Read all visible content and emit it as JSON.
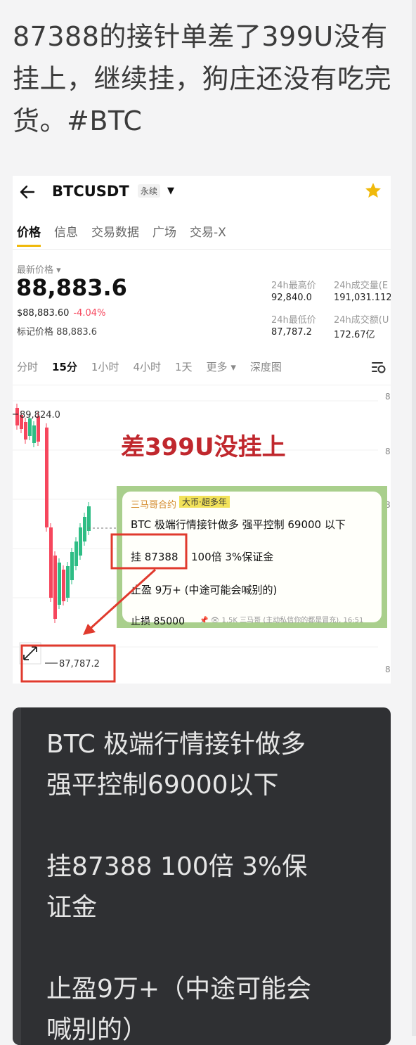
{
  "post": {
    "text": "87388的接针单差了399U没有挂上，继续挂，狗庄还没有吃完货。#BTC"
  },
  "app": {
    "symbol": "BTCUSDT",
    "badge": "永续",
    "tabs": [
      "价格",
      "信息",
      "交易数据",
      "广场",
      "交易-X"
    ],
    "latest_label": "最新价格",
    "price": "88,883.6",
    "usd_price": "$88,883.60",
    "change": "-4.04%",
    "mark_price": "标记价格 88,883.6",
    "stats": {
      "high_label": "24h最高价",
      "high": "92,840.0",
      "vol_label": "24h成交量(E",
      "vol": "191,031.112",
      "low_label": "24h最低价",
      "low": "87,787.2",
      "amt_label": "24h成交额(U",
      "amt": "172.67亿"
    },
    "intervals": [
      "分时",
      "15分",
      "1小时",
      "4小时",
      "1天",
      "更多",
      "深度图"
    ],
    "chart": {
      "high_label": "89,824.0",
      "low_label": "87,787.2",
      "right_tick": "8",
      "caption": "差399U没挂上",
      "colors": {
        "up": "#2ebd85",
        "down": "#f6465d",
        "annotation": "#e03a2d"
      }
    },
    "tg_card": {
      "author": "三马哥合约",
      "highlight": "大币·超多年",
      "line1": "BTC  极端行情接针做多 强平控制 69000 以下",
      "entry": "挂 87388",
      "entry_rest": "100倍 3%保证金",
      "tp": "止盈 9万+ (中途可能会喊别的)",
      "sl": "止损 85000",
      "meta": "1.5K 三马哥 (主动私信你的都是冒充), 16:51"
    }
  },
  "quote": {
    "text": "BTC 极端行情接针做多\n强平控制69000以下\n\n挂87388 100倍 3%保\n证金\n\n止盈9万+（中途可能会\n喊别的）"
  }
}
